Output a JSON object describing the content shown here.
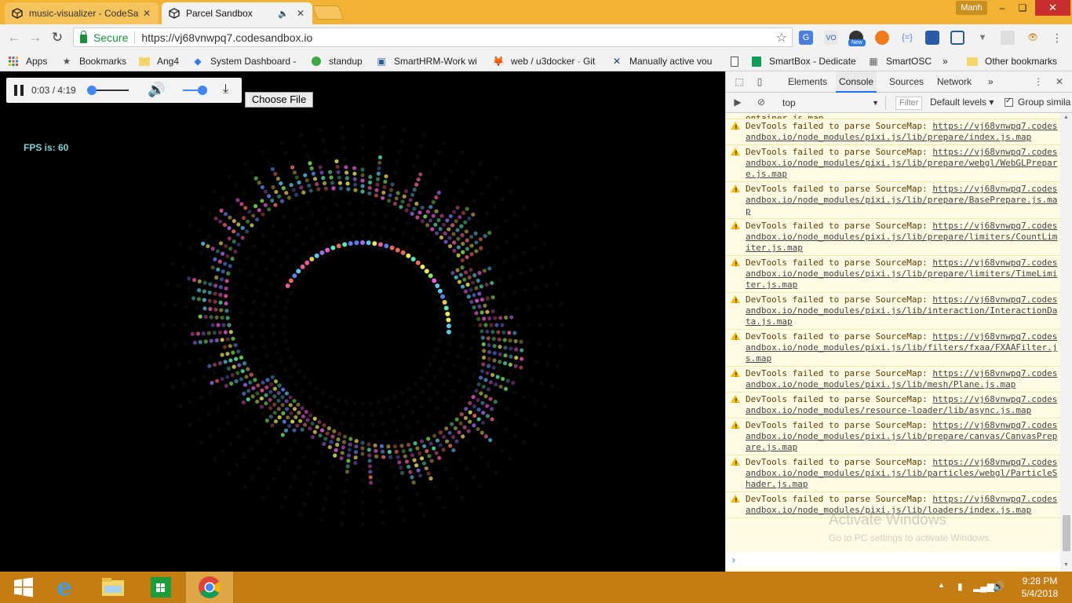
{
  "window": {
    "tabs": [
      {
        "title": "music-visualizer - CodeSa",
        "active": false
      },
      {
        "title": "Parcel Sandbox",
        "active": true
      }
    ],
    "user_label": "Manh",
    "minimize": "–",
    "maximize": "❏",
    "close": "✕"
  },
  "address": {
    "secure_label": "Secure",
    "url": "https://vj68vnwpq7.codesandbox.io",
    "ext_new_badge": "New"
  },
  "bookmarks": [
    {
      "label": "Apps",
      "icon": "apps-grid-icon"
    },
    {
      "label": "Bookmarks",
      "icon": "star-icon"
    },
    {
      "label": "Ang4",
      "icon": "folder-icon"
    },
    {
      "label": "System Dashboard -",
      "icon": "jira-icon"
    },
    {
      "label": "standup",
      "icon": "standup-icon"
    },
    {
      "label": "SmartHRM-Work wi",
      "icon": "hrm-icon"
    },
    {
      "label": "web / u3docker · Git",
      "icon": "gitlab-icon"
    },
    {
      "label": "Manually active vou",
      "icon": "x-icon"
    },
    {
      "label": "",
      "icon": "doc-icon"
    },
    {
      "label": "SmartBox - Dedicate",
      "icon": "sheet-icon"
    },
    {
      "label": "SmartOSC",
      "icon": "smartosc-icon"
    },
    {
      "label": "»",
      "icon": ""
    },
    {
      "label": "Other bookmarks",
      "icon": "folder-icon"
    }
  ],
  "player": {
    "time": "0:03 / 4:19",
    "progress": 0.012,
    "volume": 1.0
  },
  "choose_file": "Choose File",
  "fps_text": "FPS is: 60",
  "devtools": {
    "tabs": [
      "Elements",
      "Console",
      "Sources",
      "Network"
    ],
    "more": "»",
    "active_tab": "Console",
    "context": "top",
    "filter_placeholder": "Filter",
    "levels": "Default levels ▾",
    "group_similar": "Group simila",
    "top_fragment": "ontainer.js.map",
    "message_prefix": "DevTools failed to parse SourceMap: ",
    "messages": [
      "https://vj68vnwpq7.codesandbox.io/node_modules/pixi.js/lib/prepare/index.js.map",
      "https://vj68vnwpq7.codesandbox.io/node_modules/pixi.js/lib/prepare/webgl/WebGLPrepare.js.map",
      "https://vj68vnwpq7.codesandbox.io/node_modules/pixi.js/lib/prepare/BasePrepare.js.map",
      "https://vj68vnwpq7.codesandbox.io/node_modules/pixi.js/lib/prepare/limiters/CountLimiter.js.map",
      "https://vj68vnwpq7.codesandbox.io/node_modules/pixi.js/lib/prepare/limiters/TimeLimiter.js.map",
      "https://vj68vnwpq7.codesandbox.io/node_modules/pixi.js/lib/interaction/InteractionData.js.map",
      "https://vj68vnwpq7.codesandbox.io/node_modules/pixi.js/lib/filters/fxaa/FXAAFilter.js.map",
      "https://vj68vnwpq7.codesandbox.io/node_modules/pixi.js/lib/mesh/Plane.js.map",
      "https://vj68vnwpq7.codesandbox.io/node_modules/resource-loader/lib/async.js.map",
      "https://vj68vnwpq7.codesandbox.io/node_modules/pixi.js/lib/prepare/canvas/CanvasPrepare.js.map",
      "https://vj68vnwpq7.codesandbox.io/node_modules/pixi.js/lib/particles/webgl/ParticleShader.js.map",
      "https://vj68vnwpq7.codesandbox.io/node_modules/pixi.js/lib/loaders/index.js.map"
    ],
    "prompt": "›"
  },
  "watermark": {
    "title": "Activate Windows",
    "subtitle": "Go to PC settings to activate Windows."
  },
  "taskbar": {
    "time": "9:28 PM",
    "date": "5/4/2018",
    "apps": [
      "windows-start-icon",
      "ie-icon",
      "file-explorer-icon",
      "store-icon",
      "chrome-icon"
    ]
  },
  "colors": {
    "titlebar": "#f2b233",
    "taskbar": "#c47d13",
    "fps": "#7fd3d6",
    "player_accent": "#4285f4"
  }
}
